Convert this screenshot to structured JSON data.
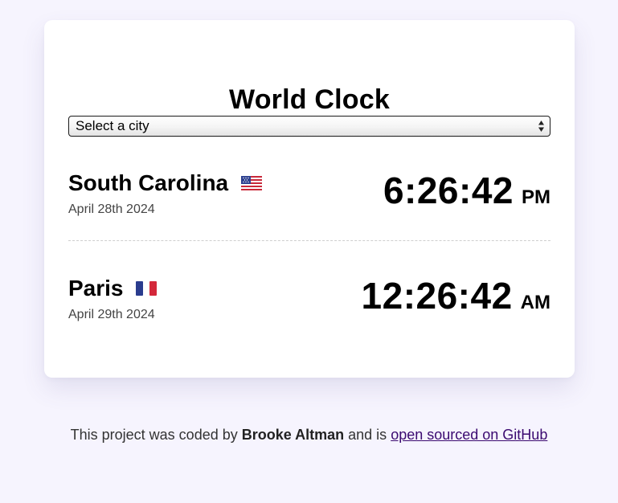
{
  "app": {
    "title": "World Clock"
  },
  "city_select": {
    "selected": "Select a city"
  },
  "cities": [
    {
      "name": "South Carolina",
      "flag": "us-flag-icon",
      "date": "April 28th 2024",
      "time": "6:26:42",
      "ampm": "PM"
    },
    {
      "name": "Paris",
      "flag": "fr-flag-icon",
      "date": "April 29th 2024",
      "time": "12:26:42",
      "ampm": "AM"
    }
  ],
  "footer": {
    "prefix": "This project was coded by",
    "author": "Brooke Altman",
    "middle": "and is",
    "link_text": "open sourced on GitHub"
  },
  "colors": {
    "page_background": "#f6f4fe",
    "card_background": "#ffffff",
    "link": "#3b0a70"
  }
}
